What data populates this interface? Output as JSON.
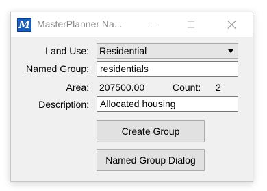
{
  "window": {
    "title": "MasterPlanner Na...",
    "app_icon_glyph": "M",
    "minimize_icon": "minimize-icon",
    "maximize_icon": "maximize-icon",
    "close_icon": "close-icon"
  },
  "form": {
    "land_use_label": "Land Use:",
    "land_use_value": "Residential",
    "named_group_label": "Named Group:",
    "named_group_value": "residentials",
    "area_label": "Area:",
    "area_value": "207500.00",
    "count_label": "Count:",
    "count_value": "2",
    "description_label": "Description:",
    "description_value": "Allocated housing"
  },
  "buttons": {
    "create_group": "Create Group",
    "named_group_dialog": "Named Group Dialog"
  },
  "colors": {
    "app_icon_bg": "#1c5fb8",
    "dialog_bg": "#f0f0f0",
    "button_bg": "#e1e1e1"
  }
}
